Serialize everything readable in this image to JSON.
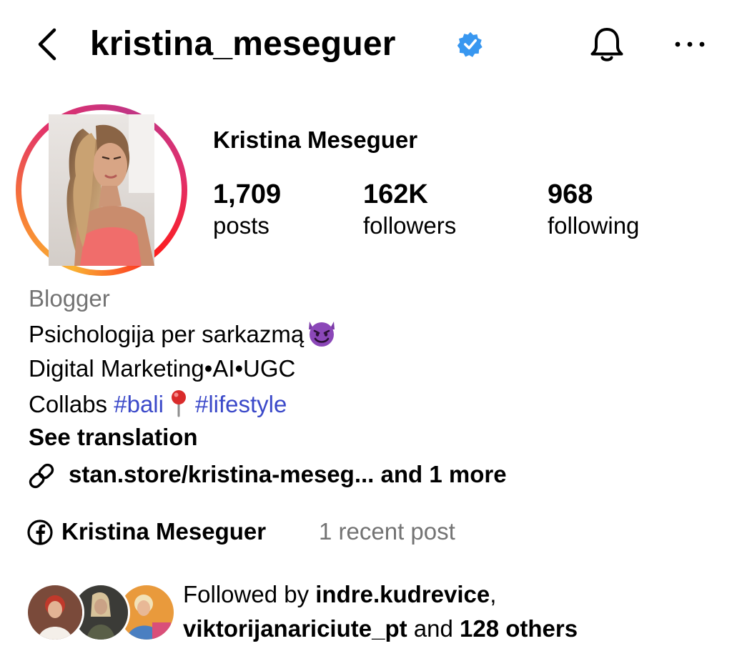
{
  "header": {
    "username": "kristina_meseguer",
    "icons": [
      "back-chevron-icon",
      "verified-badge-icon",
      "bell-icon",
      "more-options-icon"
    ],
    "verified_color": "#3897f0"
  },
  "profile": {
    "full_name": "Kristina Meseguer",
    "stats": [
      {
        "value": "1,709",
        "label": "posts"
      },
      {
        "value": "162K",
        "label": "followers"
      },
      {
        "value": "968",
        "label": "following"
      }
    ]
  },
  "bio": {
    "category": "Blogger",
    "line1": "Psichologija per sarkazmą",
    "line1_emoji": "smiling-devil-emoji",
    "line2": "Digital Marketing•AI•UGC",
    "line3_prefix": "Collabs ",
    "hashtag1": "#bali",
    "pin_emoji": "round-pushpin-emoji",
    "hashtag2": "#lifestyle",
    "see_translation": "See translation",
    "link_text": "stan.store/kristina-meseg...  and 1 more"
  },
  "facebook": {
    "name": "Kristina Meseguer",
    "recent": "1 recent post"
  },
  "followed_by": {
    "prefix": "Followed by ",
    "user1": "indre.kudrevice",
    "comma": ",",
    "user2": "viktorijanariciute_pt",
    "middle": " and ",
    "others": "128 others"
  },
  "colors": {
    "hashtag": "#3b49c9",
    "secondary_text": "#737373",
    "story_ring": [
      "#f9b233",
      "#f77737",
      "#e1306c",
      "#c13584"
    ]
  }
}
